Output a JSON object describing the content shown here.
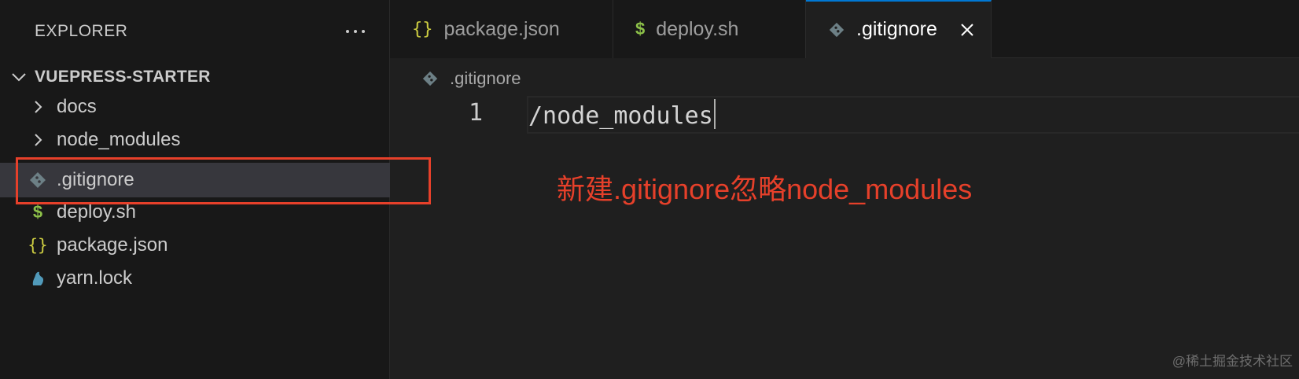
{
  "sidebar": {
    "header": "EXPLORER",
    "project": "VUEPRESS-STARTER",
    "items": [
      {
        "label": "docs",
        "icon": "chevron-right-icon"
      },
      {
        "label": "node_modules",
        "icon": "chevron-right-icon"
      },
      {
        "label": ".gitignore",
        "icon": "git-icon"
      },
      {
        "label": "deploy.sh",
        "icon": "dollar-icon",
        "glyph": "$"
      },
      {
        "label": "package.json",
        "icon": "braces-icon",
        "glyph": "{}"
      },
      {
        "label": "yarn.lock",
        "icon": "yarn-icon"
      }
    ]
  },
  "tabs": [
    {
      "label": "package.json",
      "glyph": "{}",
      "icon": "braces-icon",
      "active": false
    },
    {
      "label": "deploy.sh",
      "glyph": "$",
      "icon": "dollar-icon",
      "active": false
    },
    {
      "label": ".gitignore",
      "icon": "git-icon",
      "active": true
    }
  ],
  "breadcrumb": ".gitignore",
  "editor": {
    "line_number": "1",
    "code": "/node_modules"
  },
  "annotation": "新建.gitignore忽略node_modules",
  "watermark": "@稀土掘金技术社区",
  "colors": {
    "accent": "#0078d4",
    "annotation": "#e6402a",
    "json_icon": "#cbcb41",
    "shell_icon": "#8dc149",
    "yarn_icon": "#519aba",
    "git_icon": "#6d8086"
  }
}
